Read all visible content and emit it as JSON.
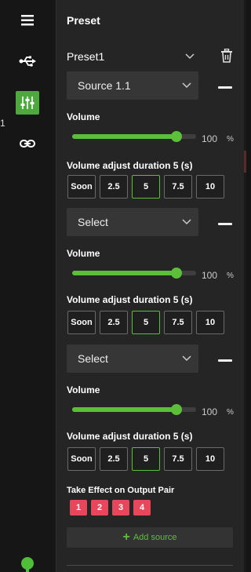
{
  "rail": {
    "icons": [
      "hamburger-menu-icon",
      "usb-icon",
      "equalizer-sliders-icon",
      "link-chain-icon"
    ],
    "active_icon": "equalizer-sliders-icon",
    "side_number": "1",
    "accent_color": "#4fa83d"
  },
  "panel": {
    "title": "Preset",
    "preset_name": "Preset1"
  },
  "sources": [
    {
      "selected": "Source 1.1",
      "volume_label": "Volume",
      "volume_value": "100",
      "volume_unit": "%",
      "volume_level_percent": 84,
      "duration_label": "Volume adjust duration 5 (s)",
      "duration_options": [
        "Soon",
        "2.5",
        "5",
        "7.5",
        "10"
      ],
      "duration_selected": "5"
    },
    {
      "selected": "Select",
      "volume_label": "Volume",
      "volume_value": "100",
      "volume_unit": "%",
      "volume_level_percent": 84,
      "duration_label": "Volume adjust duration 5 (s)",
      "duration_options": [
        "Soon",
        "2.5",
        "5",
        "7.5",
        "10"
      ],
      "duration_selected": "5"
    },
    {
      "selected": "Select",
      "volume_label": "Volume",
      "volume_value": "100",
      "volume_unit": "%",
      "volume_level_percent": 84,
      "duration_label": "Volume adjust duration 5 (s)",
      "duration_options": [
        "Soon",
        "2.5",
        "5",
        "7.5",
        "10"
      ],
      "duration_selected": "5"
    }
  ],
  "effect": {
    "label": "Take Effect on Output Pair",
    "pairs": [
      "1",
      "2",
      "3",
      "4"
    ],
    "pair_color": "#e8475b"
  },
  "add_source": {
    "icon": "plus-icon",
    "label": "Add source"
  },
  "colors": {
    "slider_fill": "#5cbf3a",
    "status": "#4fbf3a"
  }
}
